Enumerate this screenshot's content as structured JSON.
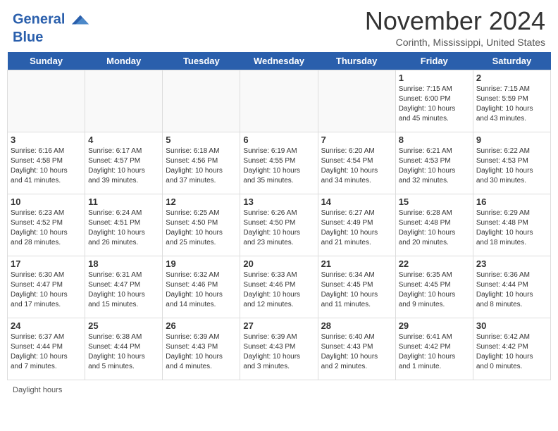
{
  "header": {
    "logo_line1": "General",
    "logo_line2": "Blue",
    "month_title": "November 2024",
    "location": "Corinth, Mississippi, United States"
  },
  "calendar": {
    "day_headers": [
      "Sunday",
      "Monday",
      "Tuesday",
      "Wednesday",
      "Thursday",
      "Friday",
      "Saturday"
    ],
    "weeks": [
      [
        {
          "day": "",
          "content": ""
        },
        {
          "day": "",
          "content": ""
        },
        {
          "day": "",
          "content": ""
        },
        {
          "day": "",
          "content": ""
        },
        {
          "day": "",
          "content": ""
        },
        {
          "day": "1",
          "content": "Sunrise: 7:15 AM\nSunset: 6:00 PM\nDaylight: 10 hours\nand 45 minutes."
        },
        {
          "day": "2",
          "content": "Sunrise: 7:15 AM\nSunset: 5:59 PM\nDaylight: 10 hours\nand 43 minutes."
        }
      ],
      [
        {
          "day": "3",
          "content": "Sunrise: 6:16 AM\nSunset: 4:58 PM\nDaylight: 10 hours\nand 41 minutes."
        },
        {
          "day": "4",
          "content": "Sunrise: 6:17 AM\nSunset: 4:57 PM\nDaylight: 10 hours\nand 39 minutes."
        },
        {
          "day": "5",
          "content": "Sunrise: 6:18 AM\nSunset: 4:56 PM\nDaylight: 10 hours\nand 37 minutes."
        },
        {
          "day": "6",
          "content": "Sunrise: 6:19 AM\nSunset: 4:55 PM\nDaylight: 10 hours\nand 35 minutes."
        },
        {
          "day": "7",
          "content": "Sunrise: 6:20 AM\nSunset: 4:54 PM\nDaylight: 10 hours\nand 34 minutes."
        },
        {
          "day": "8",
          "content": "Sunrise: 6:21 AM\nSunset: 4:53 PM\nDaylight: 10 hours\nand 32 minutes."
        },
        {
          "day": "9",
          "content": "Sunrise: 6:22 AM\nSunset: 4:53 PM\nDaylight: 10 hours\nand 30 minutes."
        }
      ],
      [
        {
          "day": "10",
          "content": "Sunrise: 6:23 AM\nSunset: 4:52 PM\nDaylight: 10 hours\nand 28 minutes."
        },
        {
          "day": "11",
          "content": "Sunrise: 6:24 AM\nSunset: 4:51 PM\nDaylight: 10 hours\nand 26 minutes."
        },
        {
          "day": "12",
          "content": "Sunrise: 6:25 AM\nSunset: 4:50 PM\nDaylight: 10 hours\nand 25 minutes."
        },
        {
          "day": "13",
          "content": "Sunrise: 6:26 AM\nSunset: 4:50 PM\nDaylight: 10 hours\nand 23 minutes."
        },
        {
          "day": "14",
          "content": "Sunrise: 6:27 AM\nSunset: 4:49 PM\nDaylight: 10 hours\nand 21 minutes."
        },
        {
          "day": "15",
          "content": "Sunrise: 6:28 AM\nSunset: 4:48 PM\nDaylight: 10 hours\nand 20 minutes."
        },
        {
          "day": "16",
          "content": "Sunrise: 6:29 AM\nSunset: 4:48 PM\nDaylight: 10 hours\nand 18 minutes."
        }
      ],
      [
        {
          "day": "17",
          "content": "Sunrise: 6:30 AM\nSunset: 4:47 PM\nDaylight: 10 hours\nand 17 minutes."
        },
        {
          "day": "18",
          "content": "Sunrise: 6:31 AM\nSunset: 4:47 PM\nDaylight: 10 hours\nand 15 minutes."
        },
        {
          "day": "19",
          "content": "Sunrise: 6:32 AM\nSunset: 4:46 PM\nDaylight: 10 hours\nand 14 minutes."
        },
        {
          "day": "20",
          "content": "Sunrise: 6:33 AM\nSunset: 4:46 PM\nDaylight: 10 hours\nand 12 minutes."
        },
        {
          "day": "21",
          "content": "Sunrise: 6:34 AM\nSunset: 4:45 PM\nDaylight: 10 hours\nand 11 minutes."
        },
        {
          "day": "22",
          "content": "Sunrise: 6:35 AM\nSunset: 4:45 PM\nDaylight: 10 hours\nand 9 minutes."
        },
        {
          "day": "23",
          "content": "Sunrise: 6:36 AM\nSunset: 4:44 PM\nDaylight: 10 hours\nand 8 minutes."
        }
      ],
      [
        {
          "day": "24",
          "content": "Sunrise: 6:37 AM\nSunset: 4:44 PM\nDaylight: 10 hours\nand 7 minutes."
        },
        {
          "day": "25",
          "content": "Sunrise: 6:38 AM\nSunset: 4:44 PM\nDaylight: 10 hours\nand 5 minutes."
        },
        {
          "day": "26",
          "content": "Sunrise: 6:39 AM\nSunset: 4:43 PM\nDaylight: 10 hours\nand 4 minutes."
        },
        {
          "day": "27",
          "content": "Sunrise: 6:39 AM\nSunset: 4:43 PM\nDaylight: 10 hours\nand 3 minutes."
        },
        {
          "day": "28",
          "content": "Sunrise: 6:40 AM\nSunset: 4:43 PM\nDaylight: 10 hours\nand 2 minutes."
        },
        {
          "day": "29",
          "content": "Sunrise: 6:41 AM\nSunset: 4:42 PM\nDaylight: 10 hours\nand 1 minute."
        },
        {
          "day": "30",
          "content": "Sunrise: 6:42 AM\nSunset: 4:42 PM\nDaylight: 10 hours\nand 0 minutes."
        }
      ]
    ]
  },
  "footer": {
    "note": "Daylight hours"
  }
}
